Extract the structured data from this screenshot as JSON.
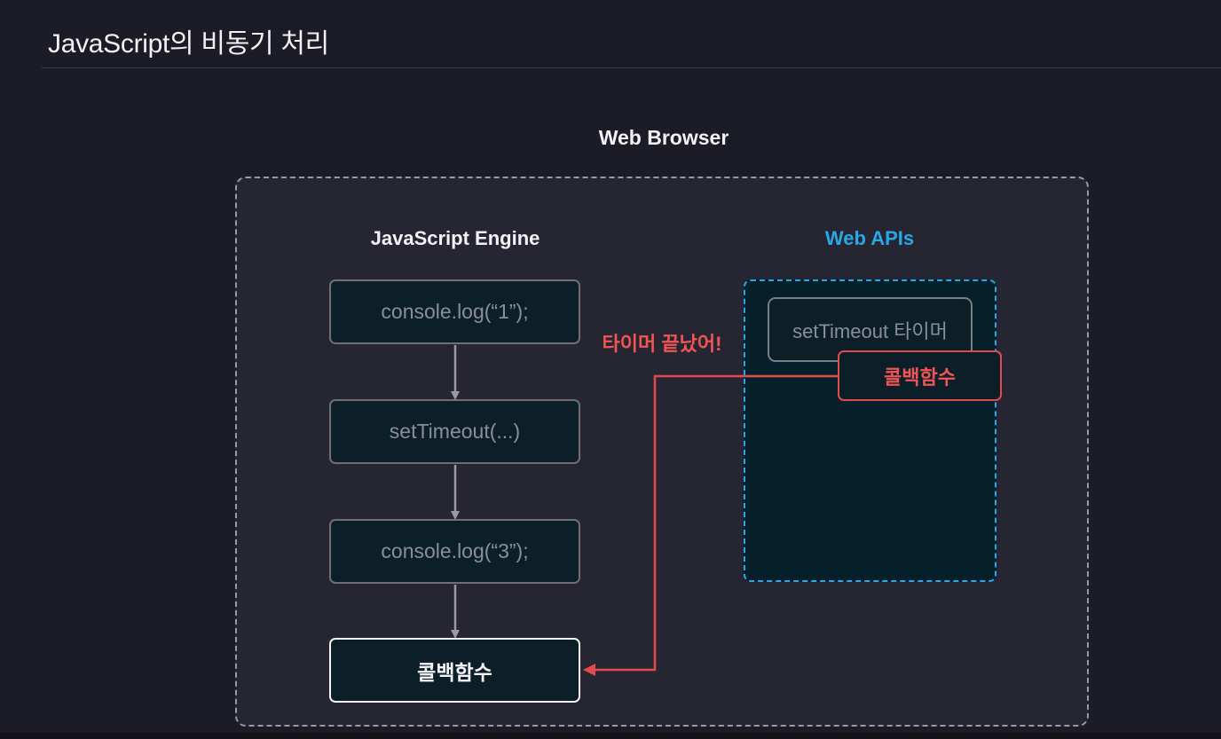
{
  "page": {
    "title": "JavaScript의 비동기 처리"
  },
  "diagram": {
    "browser_label": "Web Browser",
    "engine": {
      "label": "JavaScript Engine",
      "steps": [
        "console.log(“1”);",
        "setTimeout(...)",
        "console.log(“3”);",
        "콜백함수"
      ]
    },
    "web_apis": {
      "label": "Web APIs",
      "timer": "setTimeout 타이머",
      "callback": "콜백함수"
    },
    "annotation": "타이머 끝났어!"
  },
  "colors": {
    "background": "#1c1c27",
    "browser_box": "#262633",
    "web_apis_accent": "#2aa7e6",
    "callback_red": "#e34b4b"
  }
}
